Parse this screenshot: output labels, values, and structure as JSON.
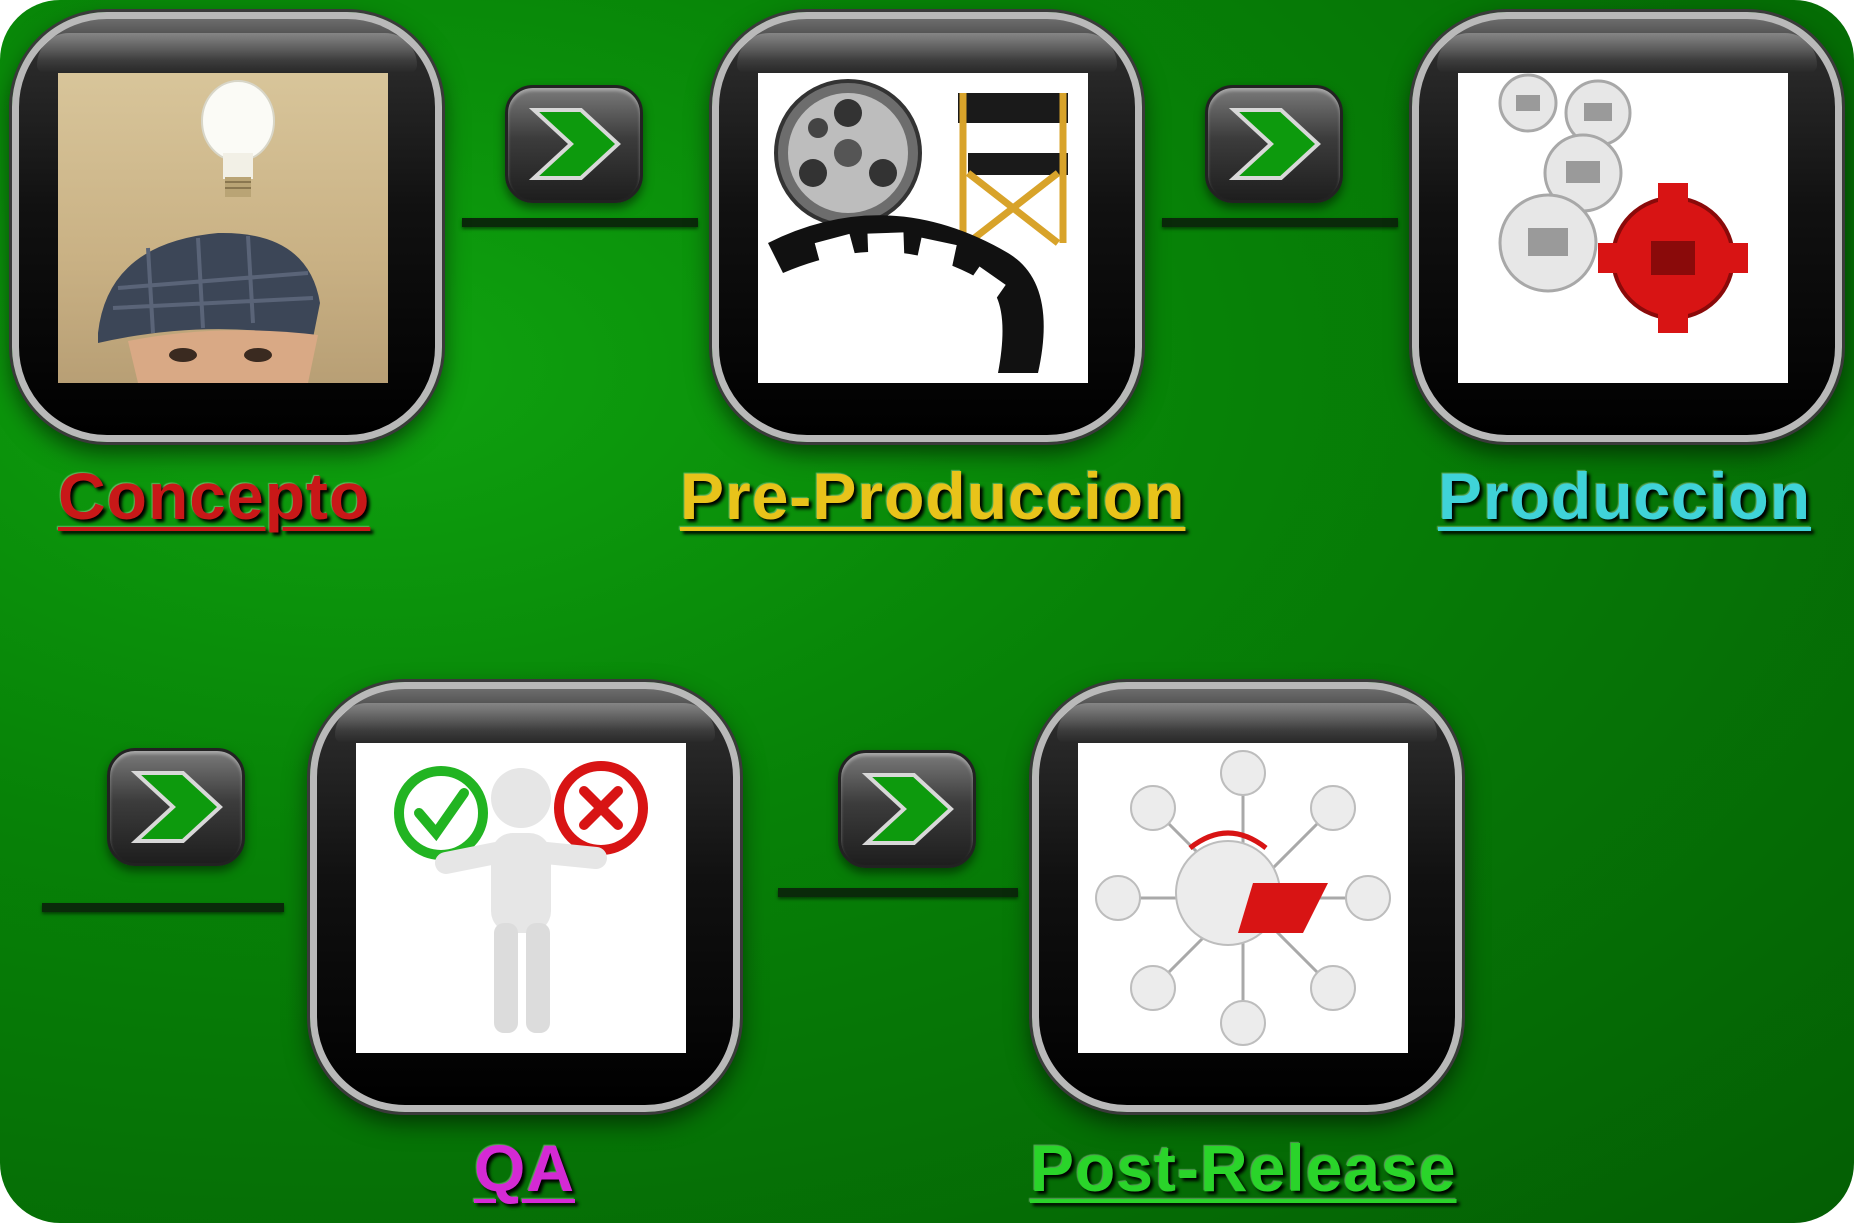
{
  "stages": [
    {
      "label": "Concepto",
      "color": "#c81818",
      "image": "idea-lightbulb-man"
    },
    {
      "label": "Pre-Produccion",
      "color": "#e8c31a",
      "image": "film-reel-directors-chair"
    },
    {
      "label": "Produccion",
      "color": "#3fd3d8",
      "image": "gears"
    },
    {
      "label": "QA",
      "color": "#d42ad4",
      "image": "approve-reject-figure"
    },
    {
      "label": "Post-Release",
      "color": "#2ad42a",
      "image": "support-network"
    }
  ],
  "colors": {
    "background": "#078207",
    "arrow_chevron": "#0d9a0d",
    "node_frame": "#111111"
  }
}
